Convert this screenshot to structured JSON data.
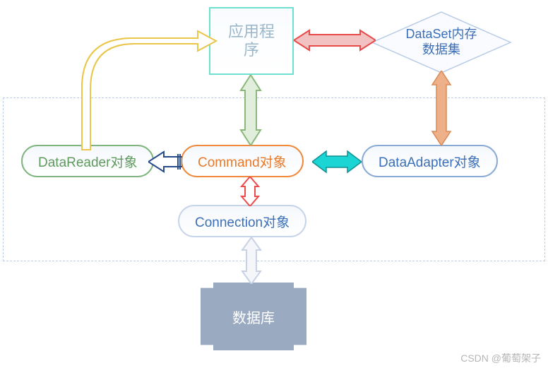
{
  "nodes": {
    "application": "应用程\n序",
    "dataset": "DataSet内存\n数据集",
    "datareader": "DataReader对象",
    "command": "Command对象",
    "dataadapter": "DataAdapter对象",
    "connection": "Connection对象",
    "database": "数据库"
  },
  "arrows": {
    "app_dataset": "double",
    "app_command": "double",
    "command_datareader": "single",
    "command_dataadapter": "double",
    "command_connection": "double",
    "connection_database": "double",
    "dataset_dataadapter": "double",
    "datareader_application": "single"
  },
  "colors": {
    "app_dataset": "#e84a4a",
    "app_command": "#8ab87a",
    "command_datareader": "#274b8a",
    "command_dataadapter": "#1bd4d4",
    "command_connection": "#f04a4a",
    "connection_database": "#c7d2e4",
    "dataset_dataadapter": "#eeb089",
    "datareader_application": "#eac64b"
  },
  "watermark": "CSDN @葡萄架子"
}
